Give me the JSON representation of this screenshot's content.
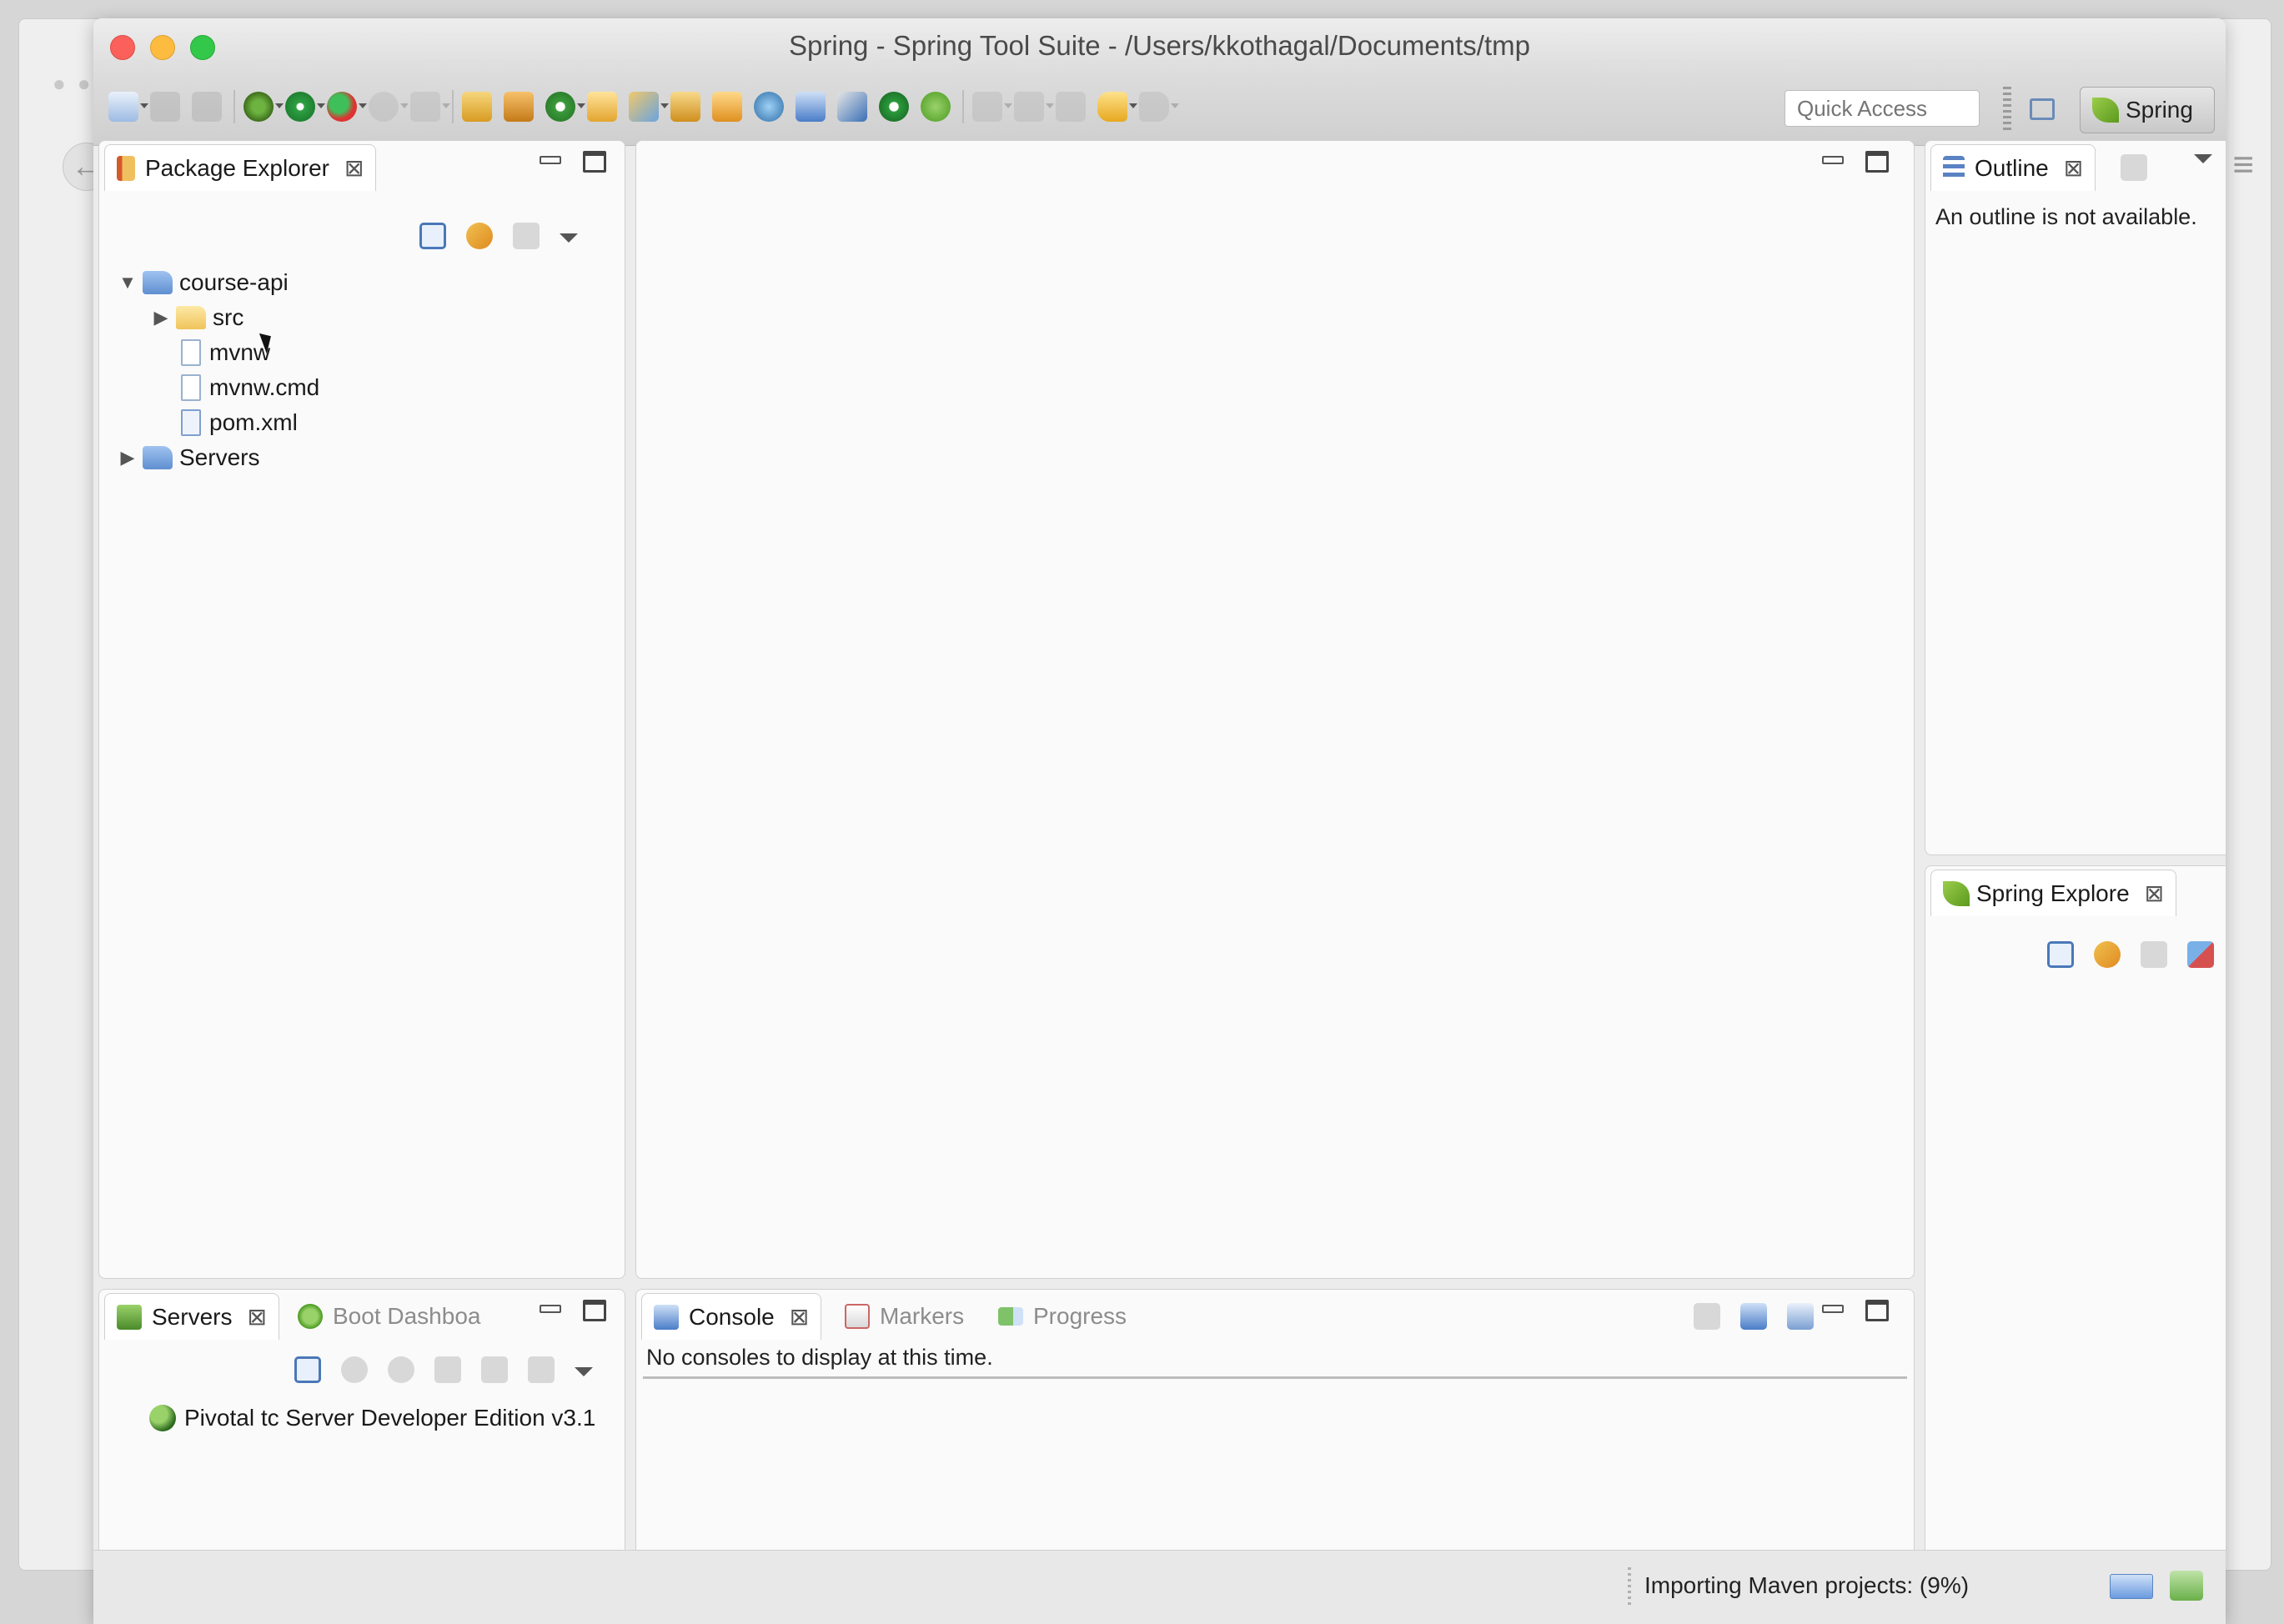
{
  "window": {
    "title": "Spring - Spring Tool Suite - /Users/kkothagal/Documents/tmp"
  },
  "toolbar": {
    "quick_access_placeholder": "Quick Access",
    "perspective_label": "Spring"
  },
  "package_explorer": {
    "tab_label": "Package Explorer",
    "tree": [
      {
        "label": "course-api",
        "type": "project",
        "expanded": true,
        "depth": 0
      },
      {
        "label": "src",
        "type": "folder",
        "expanded": false,
        "depth": 1
      },
      {
        "label": "mvnw",
        "type": "file",
        "depth": 1
      },
      {
        "label": "mvnw.cmd",
        "type": "file",
        "depth": 1
      },
      {
        "label": "pom.xml",
        "type": "xml",
        "depth": 1
      },
      {
        "label": "Servers",
        "type": "project",
        "expanded": false,
        "depth": 0
      }
    ]
  },
  "outline": {
    "tab_label": "Outline",
    "message": "An outline is not available."
  },
  "spring_explorer": {
    "tab_label": "Spring Explore"
  },
  "servers": {
    "tabs": [
      "Servers",
      "Boot Dashboa"
    ],
    "items": [
      "Pivotal tc Server Developer Edition v3.1"
    ]
  },
  "console": {
    "tabs": [
      "Console",
      "Markers",
      "Progress"
    ],
    "message": "No consoles to display at this time."
  },
  "status": {
    "text": "Importing Maven projects: (9%)",
    "progress_percent": 9
  },
  "colors": {
    "close": "#fc605b",
    "minimize": "#fdbc40",
    "zoom": "#34c84a",
    "spring_green": "#6db33f"
  }
}
